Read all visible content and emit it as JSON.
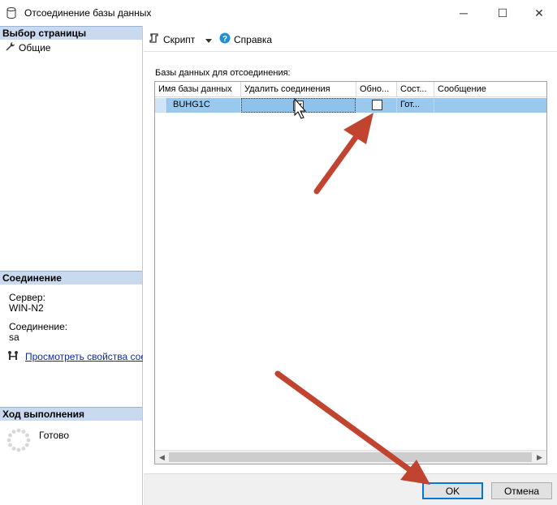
{
  "window": {
    "title": "Отсоединение базы данных",
    "controls": {
      "minimize": "─",
      "maximize": "☐",
      "close": "✕"
    }
  },
  "sidebar": {
    "page_select_header": "Выбор страницы",
    "pages": [
      {
        "label": "Общие",
        "icon": "wrench-icon"
      }
    ],
    "connection_header": "Соединение",
    "server_label": "Сервер:",
    "server_value": "WIN-N2",
    "connection_label": "Соединение:",
    "connection_value": "sa",
    "view_props_link": "Просмотреть свойства соединения",
    "progress_header": "Ход выполнения",
    "progress_status": "Готово"
  },
  "toolbar": {
    "script_label": "Скрипт",
    "help_label": "Справка"
  },
  "main": {
    "grid_label": "Базы данных для отсоединения:",
    "columns": [
      "Имя базы данных",
      "Удалить соединения",
      "Обно...",
      "Сост...",
      "Сообщение"
    ],
    "rows": [
      {
        "name": "BUHG1C",
        "drop_connections": true,
        "update_stats": false,
        "status": "Гот...",
        "message": ""
      }
    ]
  },
  "footer": {
    "ok_label": "OK",
    "cancel_label": "Отмена"
  },
  "colors": {
    "section_header": "#c9daf0",
    "selected_row": "#99c9ef",
    "annotation_arrow": "#c0442f",
    "link": "#0b2ba8",
    "default_button_border": "#0078d7"
  }
}
